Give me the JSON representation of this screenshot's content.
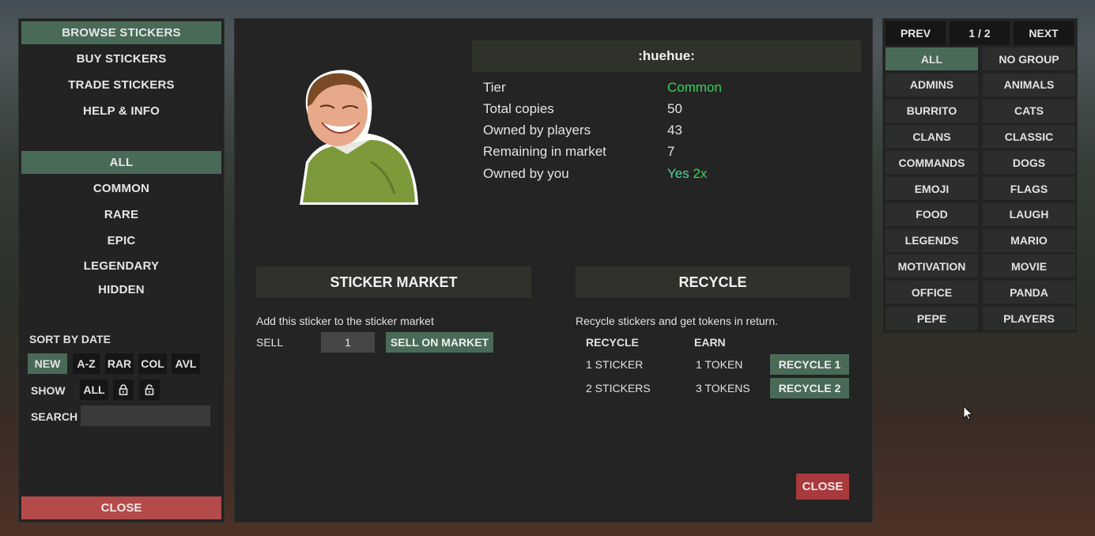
{
  "left": {
    "nav": [
      "BROWSE STICKERS",
      "BUY STICKERS",
      "TRADE STICKERS",
      "HELP & INFO"
    ],
    "tiers": [
      "ALL",
      "COMMON",
      "RARE",
      "EPIC",
      "LEGENDARY",
      "HIDDEN"
    ],
    "sort_label": "SORT BY DATE",
    "sort_options": [
      "NEW",
      "A-Z",
      "RAR",
      "COL",
      "AVL"
    ],
    "show_label": "SHOW",
    "show_all": "ALL",
    "search_label": "SEARCH",
    "search_value": "",
    "close": "CLOSE"
  },
  "sticker": {
    "name": ":huehue:",
    "rows": [
      {
        "label": "Tier",
        "value": "Common"
      },
      {
        "label": "Total copies",
        "value": "50"
      },
      {
        "label": "Owned by players",
        "value": "43"
      },
      {
        "label": "Remaining in market",
        "value": "7"
      },
      {
        "label": "Owned by you",
        "value": "Yes",
        "suffix": "2x"
      }
    ]
  },
  "market": {
    "header": "STICKER MARKET",
    "desc": "Add this sticker to the sticker market",
    "sell_label": "SELL",
    "quantity": "1",
    "button": "SELL ON MARKET"
  },
  "recycle": {
    "header": "RECYCLE",
    "desc": "Recycle stickers and get tokens in return.",
    "col_recycle": "RECYCLE",
    "col_earn": "EARN",
    "rows": [
      {
        "recycle": "1 STICKER",
        "earn": "1 TOKEN",
        "button": "RECYCLE 1"
      },
      {
        "recycle": "2 STICKERS",
        "earn": "3 TOKENS",
        "button": "RECYCLE 2"
      }
    ]
  },
  "center_close": "CLOSE",
  "groups": {
    "prev": "PREV",
    "page": "1 / 2",
    "next": "NEXT",
    "items": [
      "ALL",
      "NO GROUP",
      "ADMINS",
      "ANIMALS",
      "BURRITO",
      "CATS",
      "CLANS",
      "CLASSIC",
      "COMMANDS",
      "DOGS",
      "EMOJI",
      "FLAGS",
      "FOOD",
      "LAUGH",
      "LEGENDS",
      "MARIO",
      "MOTIVATION",
      "MOVIE",
      "OFFICE",
      "PANDA",
      "PEPE",
      "PLAYERS"
    ]
  },
  "colors": {
    "accent_green": "#4a6a58",
    "close_red": "#b44a4a",
    "tier_common": "#39d35a"
  }
}
